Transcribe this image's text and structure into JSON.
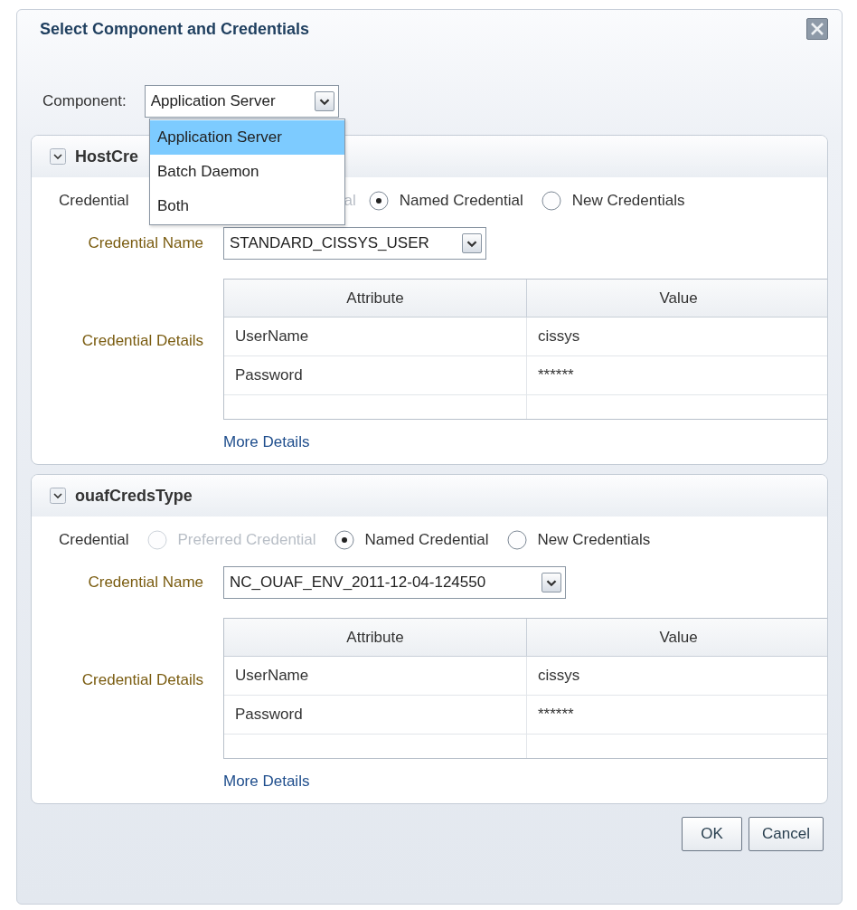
{
  "dialog": {
    "title": "Select Component and Credentials"
  },
  "component": {
    "label": "Component:",
    "value": "Application Server",
    "expanded": true,
    "options": [
      {
        "label": "Application Server",
        "selected": true
      },
      {
        "label": "Batch Daemon",
        "selected": false
      },
      {
        "label": "Both",
        "selected": false
      }
    ]
  },
  "sections": [
    {
      "title": "HostCre",
      "expanded": true,
      "credential_label": "Credential",
      "options": [
        {
          "kind": "clipped",
          "label": "al",
          "disabled": true
        },
        {
          "kind": "radio",
          "label": "Named Credential",
          "disabled": false,
          "selected": true
        },
        {
          "kind": "radio",
          "label": "New Credentials",
          "disabled": false,
          "selected": false
        }
      ],
      "name_label": "Credential Name",
      "name_value": "STANDARD_CISSYS_USER",
      "details_label": "Credential Details",
      "columns": [
        "Attribute",
        "Value"
      ],
      "rows": [
        [
          "UserName",
          "cissys"
        ],
        [
          "Password",
          "******"
        ]
      ],
      "link": "More Details"
    },
    {
      "title": "ouafCredsType",
      "expanded": true,
      "credential_label": "Credential",
      "options": [
        {
          "kind": "radio",
          "label": "Preferred Credential",
          "disabled": true,
          "selected": false
        },
        {
          "kind": "radio",
          "label": "Named Credential",
          "disabled": false,
          "selected": true
        },
        {
          "kind": "radio",
          "label": "New Credentials",
          "disabled": false,
          "selected": false
        }
      ],
      "name_label": "Credential Name",
      "name_value": "NC_OUAF_ENV_2011-12-04-124550",
      "details_label": "Credential Details",
      "columns": [
        "Attribute",
        "Value"
      ],
      "rows": [
        [
          "UserName",
          "cissys"
        ],
        [
          "Password",
          "******"
        ]
      ],
      "link": "More Details"
    }
  ],
  "buttons": [
    "OK",
    "Cancel"
  ]
}
